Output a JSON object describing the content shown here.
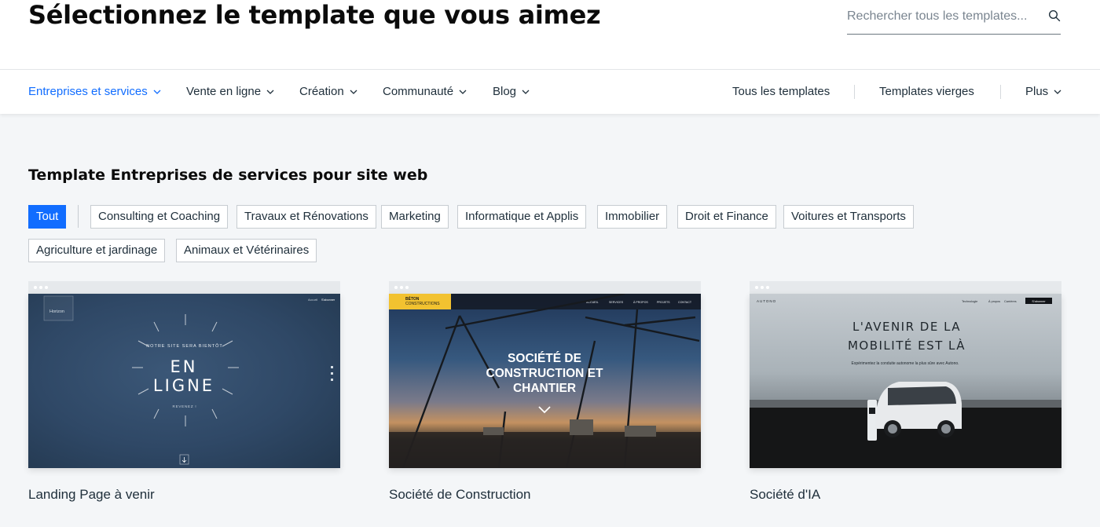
{
  "header": {
    "title": "Sélectionnez le template que vous aimez",
    "search_placeholder": "Rechercher tous les templates..."
  },
  "nav": {
    "left": [
      {
        "label": "Entreprises et services",
        "active": true
      },
      {
        "label": "Vente en ligne",
        "active": false
      },
      {
        "label": "Création",
        "active": false
      },
      {
        "label": "Communauté",
        "active": false
      },
      {
        "label": "Blog",
        "active": false
      }
    ],
    "right": {
      "all": "Tous les templates",
      "blank": "Templates vierges",
      "more": "Plus"
    }
  },
  "section": {
    "title": "Template Entreprises de services pour site web"
  },
  "filters": [
    "Tout",
    "Consulting et Coaching",
    "Travaux et Rénovations",
    "Marketing",
    "Informatique et Applis",
    "Immobilier",
    "Droit et Finance",
    "Voitures et Transports",
    "Agriculture et jardinage",
    "Animaux et Vétérinaires"
  ],
  "active_filter": "Tout",
  "cards": [
    {
      "title": "Landing Page à venir",
      "thumb": {
        "logo": "Horizon",
        "nav_a": "Accueil",
        "nav_b": "S'abonner",
        "kicker": "NOTRE SITE SERA BIENTÔT",
        "headline_1": "EN",
        "headline_2": "LIGNE",
        "sub": "REVENEZ !"
      }
    },
    {
      "title": "Société de Construction",
      "thumb": {
        "logo_1": "BÉTON",
        "logo_2": "CONSTRUCTIONS",
        "menu": [
          "ACCUEIL",
          "SERVICES",
          "À PROPOS",
          "PROJETS",
          "CONTACT"
        ],
        "headline_1": "SOCIÉTÉ DE",
        "headline_2": "CONSTRUCTION ET",
        "headline_3": "CHANTIER"
      }
    },
    {
      "title": "Société d'IA",
      "thumb": {
        "logo": "AUTONO",
        "menu": [
          "Technologie",
          "À propos",
          "Carrières"
        ],
        "cta": "S'abonner",
        "headline_1": "L'AVENIR DE LA",
        "headline_2": "MOBILITÉ EST LÀ",
        "sub": "Expérimentez la conduite autonome la plus sûre avec Autono."
      }
    }
  ],
  "colors": {
    "accent": "#116dff",
    "page_bg": "#f4f6f8",
    "text": "#20303c"
  },
  "icons": {
    "search": "search-icon",
    "chevron": "chevron-down-icon"
  }
}
